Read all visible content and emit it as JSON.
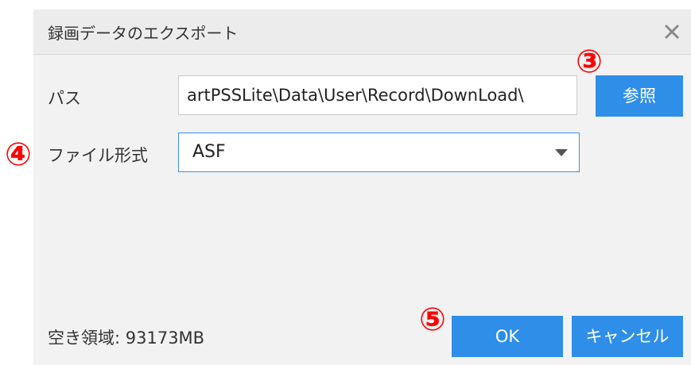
{
  "dialog": {
    "title": "録画データのエクスポート",
    "close_icon": "close-icon"
  },
  "form": {
    "path_label": "パス",
    "path_value": "artPSSLite\\Data\\User\\Record\\DownLoad\\",
    "browse_label": "参照",
    "format_label": "ファイル形式",
    "format_value": "ASF"
  },
  "footer": {
    "free_space": "空き領域: 93173MB",
    "ok_label": "OK",
    "cancel_label": "キャンセル"
  },
  "annotations": {
    "marker_3": "③",
    "marker_4": "④",
    "marker_5": "⑤"
  },
  "colors": {
    "accent": "#2f8ee8",
    "marker": "#ff0000",
    "dialog_bg": "#f2f2f2"
  }
}
